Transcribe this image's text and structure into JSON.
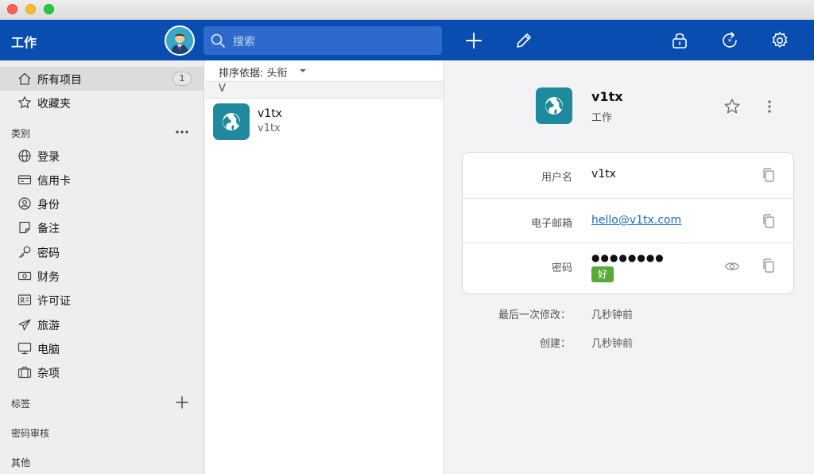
{
  "toolbar": {
    "vault_name": "工作",
    "search_placeholder": "搜索"
  },
  "sidebar": {
    "top_items": [
      {
        "label": "所有项目",
        "count": "1"
      },
      {
        "label": "收藏夹"
      }
    ],
    "categories_header": "类别",
    "categories": [
      {
        "label": "登录"
      },
      {
        "label": "信用卡"
      },
      {
        "label": "身份"
      },
      {
        "label": "备注"
      },
      {
        "label": "密码"
      },
      {
        "label": "财务"
      },
      {
        "label": "许可证"
      },
      {
        "label": "旅游"
      },
      {
        "label": "电脑"
      },
      {
        "label": "杂项"
      }
    ],
    "tags_header": "标签",
    "audit_header": "密码审核",
    "other_header": "其他"
  },
  "list": {
    "sort_label": "排序依据: 头衔",
    "group_letter": "V",
    "items": [
      {
        "title": "v1tx",
        "subtitle": "v1tx"
      }
    ]
  },
  "detail": {
    "title": "v1tx",
    "vault": "工作",
    "fields": [
      {
        "key": "用户名",
        "value": "v1tx"
      },
      {
        "key": "电子邮箱",
        "value": "hello@v1tx.com"
      },
      {
        "key": "密码",
        "value": "●●●●●●●●",
        "strength": "好"
      }
    ],
    "meta": [
      {
        "key": "最后一次修改：",
        "value": "几秒钟前"
      },
      {
        "key": "创建：",
        "value": "几秒钟前"
      }
    ]
  },
  "colors": {
    "toolbar_bg": "#0a4db0",
    "item_icon": "#1f8a9d",
    "strength_good": "#5aa838",
    "link": "#1c6ac9"
  }
}
